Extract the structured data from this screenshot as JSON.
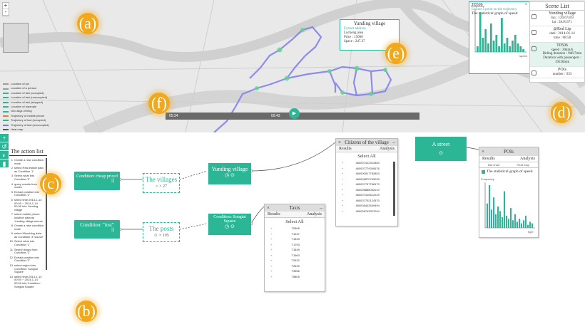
{
  "map": {
    "zoom_in": "+",
    "zoom_out": "-",
    "legend": [
      {
        "label": "Location of poi",
        "color": "#9e9e9e"
      },
      {
        "label": "Location of a person",
        "color": "#9e9e9e"
      },
      {
        "label": "Location of taxi (occupied)",
        "color": "#2bb796"
      },
      {
        "label": "Location of taxi (unoccupied)",
        "color": "#2bb796"
      },
      {
        "label": "Location of taxi (stopped)",
        "color": "#2bb796"
      },
      {
        "label": "Location of a/people",
        "color": "#2bb796"
      },
      {
        "label": "Geo-tags of blog",
        "color": "#2bb796"
      },
      {
        "label": "Trajectory of mobile phone",
        "color": "#e07b39"
      },
      {
        "label": "Trajectory of taxi (occupied)",
        "color": "#2bb796"
      },
      {
        "label": "Trajectory of taxi (unoccupied)",
        "color": "#7c7cd8"
      },
      {
        "label": "Heat map",
        "color": "#555555"
      }
    ],
    "timeline": {
      "start": "05:34",
      "mid": "09:43"
    },
    "popup": {
      "title": "Yunding village",
      "address_label": "Extract address",
      "area": "Lucheng area",
      "price": "Price : 15060",
      "space": "Space : 247.37"
    },
    "chart_window": {
      "id": "T0506",
      "subtitle": "Extract a point on the trajectory",
      "title": "The statistical graph of speed",
      "y_axis": "Frequency",
      "x_axis": "speed"
    },
    "scene_list": {
      "header": "Scene List",
      "items": [
        {
          "name": "Yunding village",
          "lines": [
            "lon : 120.67459",
            "lat : 28.01371"
          ]
        },
        {
          "name": "@Red Lip",
          "lines": [
            "date : 2014-01-14",
            "time : 08:58"
          ]
        },
        {
          "name": "T0506",
          "lines": [
            "speed : 30km/h",
            "Riding duration : 9d6/7min",
            "Duration with passengers :",
            "19530min"
          ]
        },
        {
          "name": "POIs",
          "lines": [
            "number : 933"
          ]
        }
      ]
    }
  },
  "badges": {
    "a": "(a)",
    "b": "(b)",
    "c": "(c)",
    "d": "(d)",
    "e": "(e)",
    "f": "(f)"
  },
  "toolbar": [
    "+",
    "↺",
    "◐",
    "▮"
  ],
  "action_list": {
    "title": "The action list",
    "items": [
      {
        "n": "1",
        "text": "Create a new condition node"
      },
      {
        "n": "2",
        "text": "select Real estate data as Condition '1'"
      },
      {
        "n": "3",
        "text": "Select what into Condition '0'"
      },
      {
        "n": "4",
        "text": "query results from nodes"
      },
      {
        "n": "5",
        "text": "Extract position into Condition '2'"
      },
      {
        "n": "6",
        "text": "select time:2014-1-14 00:00 ~ 2014-1-14 00:00 into Yunding village"
      },
      {
        "n": "7",
        "text": "select mobile phone location data as Yunding village source"
      },
      {
        "n": "8",
        "text": "Create a new condition node"
      },
      {
        "n": "9",
        "text": "select Microblog data as Condition '3' source"
      },
      {
        "n": "10",
        "text": "Select what into Condition '1'"
      },
      {
        "n": "11",
        "text": "Search blogs from Condition '1'"
      },
      {
        "n": "12",
        "text": "Extract position into Condition '3'"
      },
      {
        "n": "13",
        "text": "select region into Condition: Songtai Square"
      },
      {
        "n": "14",
        "text": "select time:2014-1-14 00:00 ~ 2014-1-14 00:00 into Condition: Songtai Square"
      }
    ]
  },
  "flow": {
    "cond1": "Condition: cheap priced",
    "cond2": "Condition: \"lost\"",
    "villages": "The villages",
    "villages_count": "27",
    "posts": "The posts",
    "posts_count": "105",
    "yunding": "Yunding village",
    "songtai": "Condition: Songtai Square",
    "street": "A street"
  },
  "citizens": {
    "title": "Citizens of the village",
    "tab_results": "Results",
    "tab_analysis": "Analysis",
    "select_all": "Select All",
    "rows": [
      "460007412323463",
      "460007779300676",
      "460000517782803",
      "460006570700033",
      "460007797768170",
      "460006888052010",
      "460007410612229",
      "460007702124370",
      "460008442649494",
      "460008743327094"
    ]
  },
  "taxis": {
    "title": "Taxis",
    "tab_results": "Results",
    "tab_analysis": "Analysis",
    "select_all": "Select All",
    "rows": [
      "T0506",
      "T1237",
      "T1333",
      "T1793",
      "T1849",
      "T1963",
      "T2632",
      "T2639",
      "T3356",
      "T5805"
    ]
  },
  "pois": {
    "title": "POIs",
    "tab_results": "Results",
    "tab_analysis": "Analysis",
    "sub_bar": "Bar chart",
    "sub_heat": "Heat map",
    "graph_title": "The statistical graph of speed",
    "y_axis": "Frequency",
    "x_axis": "type"
  },
  "chart_data": [
    {
      "type": "bar",
      "title": "The statistical graph of speed",
      "ylabel": "Frequency",
      "xlabel": "speed",
      "values": [
        2,
        14,
        5,
        8,
        3,
        10,
        4,
        6,
        2,
        12,
        3,
        5,
        2,
        4,
        6,
        3,
        2,
        1
      ]
    },
    {
      "type": "bar",
      "title": "The statistical graph of speed",
      "ylabel": "Frequency",
      "xlabel": "type",
      "values": [
        16,
        28,
        12,
        20,
        9,
        14,
        11,
        7,
        24,
        8,
        6,
        13,
        5,
        9,
        4,
        6,
        3,
        5,
        8,
        2,
        4,
        3
      ]
    }
  ]
}
